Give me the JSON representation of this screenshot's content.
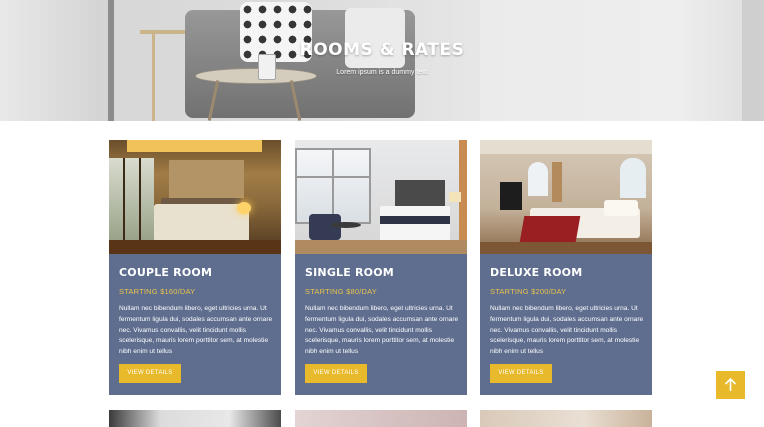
{
  "hero": {
    "title": "ROOMS & RATES",
    "subtitle": "Lorem ipsum is a dummy text"
  },
  "rooms": [
    {
      "title": "COUPLE ROOM",
      "price": "STARTING $160/DAY",
      "description": "Nullam nec bibendum libero, eget ultricies urna. Ut fermentum ligula dui, sodales accumsan ante ornare nec. Vivamus convallis, velit tincidunt mollis scelerisque, mauris lorem porttitor sem, at molestie nibh enim ut tellus",
      "button": "VIEW DETAILS"
    },
    {
      "title": "SINGLE ROOM",
      "price": "STARTING $80/DAY",
      "description": "Nullam nec bibendum libero, eget ultricies urna. Ut fermentum ligula dui, sodales accumsan ante ornare nec. Vivamus convallis, velit tincidunt mollis scelerisque, mauris lorem porttitor sem, at molestie nibh enim ut tellus",
      "button": "VIEW DETAILS"
    },
    {
      "title": "DELUXE ROOM",
      "price": "STARTING $200/DAY",
      "description": "Nullam nec bibendum libero, eget ultricies urna. Ut fermentum ligula dui, sodales accumsan ante ornare nec. Vivamus convallis, velit tincidunt mollis scelerisque, mauris lorem porttitor sem, at molestie nibh enim ut tellus",
      "button": "VIEW DETAILS"
    }
  ],
  "back_to_top": {
    "icon": "arrow-up-icon"
  },
  "colors": {
    "card_background": "#5f6e8f",
    "accent": "#e7b92b",
    "price": "#e9c34a"
  }
}
